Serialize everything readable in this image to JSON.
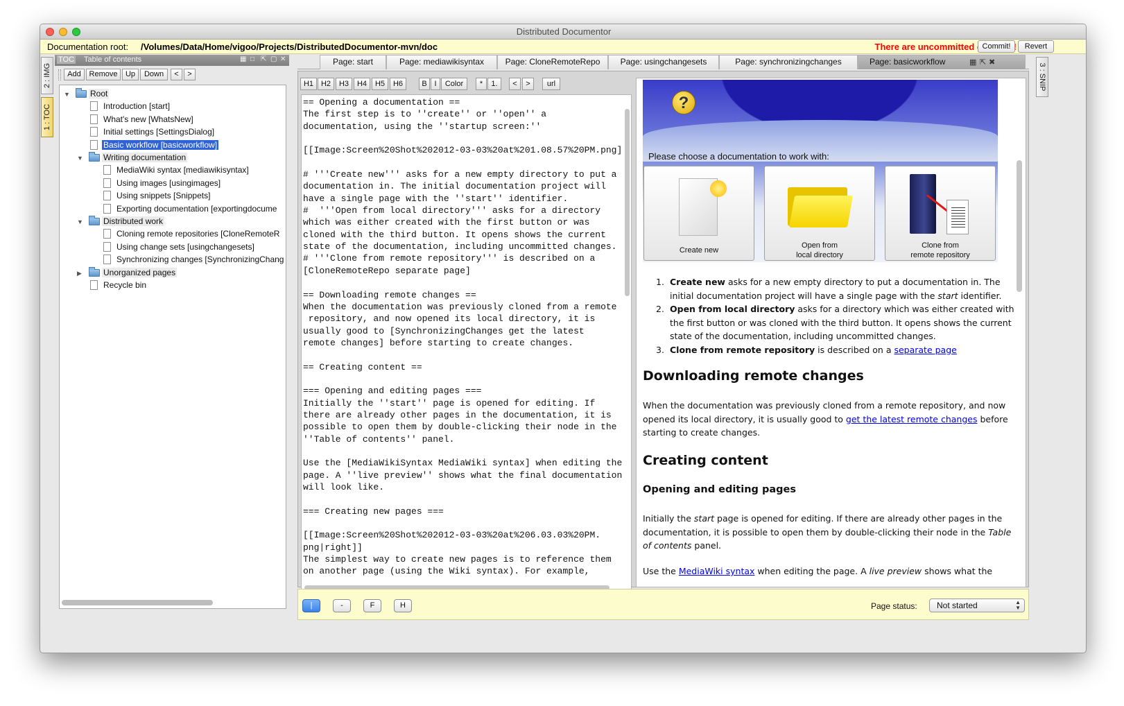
{
  "window": {
    "title": "Distributed Documentor"
  },
  "rootbar": {
    "label": "Documentation root:",
    "path": "/Volumes/Data/Home/vigoo/Projects/DistributedDocumentor-mvn/doc",
    "warning": "There are uncommitted changes!",
    "commit_label": "Commit!",
    "revert_label": "Revert"
  },
  "side_tabs": {
    "img": "2 : IMG",
    "toc": "1 : TOC",
    "snip": "3 : SNIP"
  },
  "toc": {
    "abbr": "TOC",
    "title": "Table of contents",
    "toolbar": {
      "add": "Add",
      "remove": "Remove",
      "up": "Up",
      "down": "Down",
      "left": "<",
      "right": ">"
    },
    "tree": [
      {
        "label": "Root",
        "kind": "folder",
        "level": 0,
        "expanded": true
      },
      {
        "label": "Introduction [start]",
        "kind": "page",
        "level": 1
      },
      {
        "label": "What's new [WhatsNew]",
        "kind": "page",
        "level": 1
      },
      {
        "label": "Initial settings [SettingsDialog]",
        "kind": "page",
        "level": 1
      },
      {
        "label": "Basic workflow [basicworkflow]",
        "kind": "page",
        "level": 1,
        "selected": true
      },
      {
        "label": "Writing documentation",
        "kind": "folder",
        "level": 1,
        "expanded": true
      },
      {
        "label": "MediaWiki syntax [mediawikisyntax]",
        "kind": "page",
        "level": 2
      },
      {
        "label": "Using images [usingimages]",
        "kind": "page",
        "level": 2
      },
      {
        "label": "Using snippets [Snippets]",
        "kind": "page",
        "level": 2
      },
      {
        "label": "Exporting documentation [exportingdocume",
        "kind": "page",
        "level": 2
      },
      {
        "label": "Distributed work",
        "kind": "folder",
        "level": 1,
        "expanded": true
      },
      {
        "label": "Cloning remote repositories [CloneRemoteR",
        "kind": "page",
        "level": 2
      },
      {
        "label": "Using change sets [usingchangesets]",
        "kind": "page",
        "level": 2
      },
      {
        "label": "Synchronizing changes [SynchronizingChang",
        "kind": "page",
        "level": 2
      },
      {
        "label": "Unorganized pages",
        "kind": "folder",
        "level": 1,
        "expanded": false
      },
      {
        "label": "Recycle bin",
        "kind": "page",
        "level": 1
      }
    ]
  },
  "tabs": [
    {
      "label": "Page: start"
    },
    {
      "label": "Page: mediawikisyntax"
    },
    {
      "label": "Page: CloneRemoteRepo"
    },
    {
      "label": "Page: usingchangesets"
    },
    {
      "label": "Page: synchronizingchanges"
    },
    {
      "label": "Page: basicworkflow",
      "active": true
    }
  ],
  "format_toolbar": {
    "h1": "H1",
    "h2": "H2",
    "h3": "H3",
    "h4": "H4",
    "h5": "H5",
    "h6": "H6",
    "bold": "B",
    "italic": "I",
    "color": "Color",
    "bullet": "*",
    "numbered": "1.",
    "outdent": "<",
    "indent": ">",
    "url": "url"
  },
  "source_lines": [
    "== Opening a documentation ==",
    "The first step is to ''create'' or ''open'' a",
    "documentation, using the ''startup screen:''",
    "",
    "[[Image:Screen%20Shot%202012-03-03%20at%201.08.57%20PM.png]",
    "",
    "# '''Create new''' asks for a new empty directory to put a",
    "documentation in. The initial documentation project will",
    "have a single page with the ''start'' identifier.",
    "#  '''Open from local directory''' asks for a directory",
    "which was either created with the first button or was",
    "cloned with the third button. It opens shows the current",
    "state of the documentation, including uncommitted changes.",
    "# '''Clone from remote repository''' is described on a",
    "[CloneRemoteRepo separate page]",
    "",
    "== Downloading remote changes ==",
    "When the documentation was previously cloned from a remote",
    " repository, and now opened its local directory, it is",
    "usually good to [SynchronizingChanges get the latest",
    "remote changes] before starting to create changes.",
    "",
    "== Creating content ==",
    "",
    "=== Opening and editing pages ===",
    "Initially the ''start'' page is opened for editing. If",
    "there are already other pages in the documentation, it is",
    "possible to open them by double-clicking their node in the",
    "''Table of contents'' panel.",
    "",
    "Use the [MediaWikiSyntax MediaWiki syntax] when editing the",
    "page. A ''live preview'' shows what the final documentation",
    "will look like.",
    "",
    "=== Creating new pages ===",
    "",
    "[[Image:Screen%20Shot%202012-03-03%20at%206.03.03%20PM.",
    "png|right]]",
    "The simplest way to create new pages is to reference them",
    "on another page (using the Wiki syntax). For example,"
  ],
  "preview": {
    "startup": {
      "prompt": "Please choose a documentation to work with:",
      "create_new": "Create new",
      "open_line1": "Open from",
      "open_line2": "local directory",
      "clone_line1": "Clone from",
      "clone_line2": "remote repository"
    },
    "list": [
      {
        "num": "1.",
        "bold": "Create new",
        "rest": " asks for a new empty directory to put a documentation in. The initial documentation project will have a single page with the ",
        "em": "start",
        "tail": " identifier."
      },
      {
        "num": "2.",
        "bold": "Open from local directory",
        "rest": " asks for a directory which was either created with the first button or was cloned with the third button. It opens shows the current state of the documentation, including uncommitted changes."
      },
      {
        "num": "3.",
        "bold": "Clone from remote repository",
        "rest": " is described on a ",
        "link": "separate page"
      }
    ],
    "h_downloading": "Downloading remote changes",
    "p_downloading_pre": "When the documentation was previously cloned from a remote repository, and now opened its local directory, it is usually good to ",
    "p_downloading_link": "get the latest remote changes",
    "p_downloading_post": " before starting to create changes.",
    "h_creating": "Creating content",
    "h_opening": "Opening and editing pages",
    "p_opening_1": "Initially the ",
    "p_opening_em1": "start",
    "p_opening_2": " page is opened for editing. If there are already other pages in the documentation, it is possible to open them by double-clicking their node in the ",
    "p_opening_em2": "Table of contents",
    "p_opening_3": " panel.",
    "p_use_1": "Use the ",
    "p_use_link": "MediaWiki syntax",
    "p_use_2": " when editing the page. A ",
    "p_use_em": "live preview",
    "p_use_3": " shows what the"
  },
  "bottom": {
    "view_buttons": [
      "|",
      "-",
      "F",
      "H"
    ],
    "page_status_label": "Page status:",
    "page_status_value": "Not started"
  },
  "colors": {
    "warning": "#ff0000",
    "selection": "#2f62d6",
    "info_bar": "#fdfccc",
    "link": "#0000ee"
  }
}
